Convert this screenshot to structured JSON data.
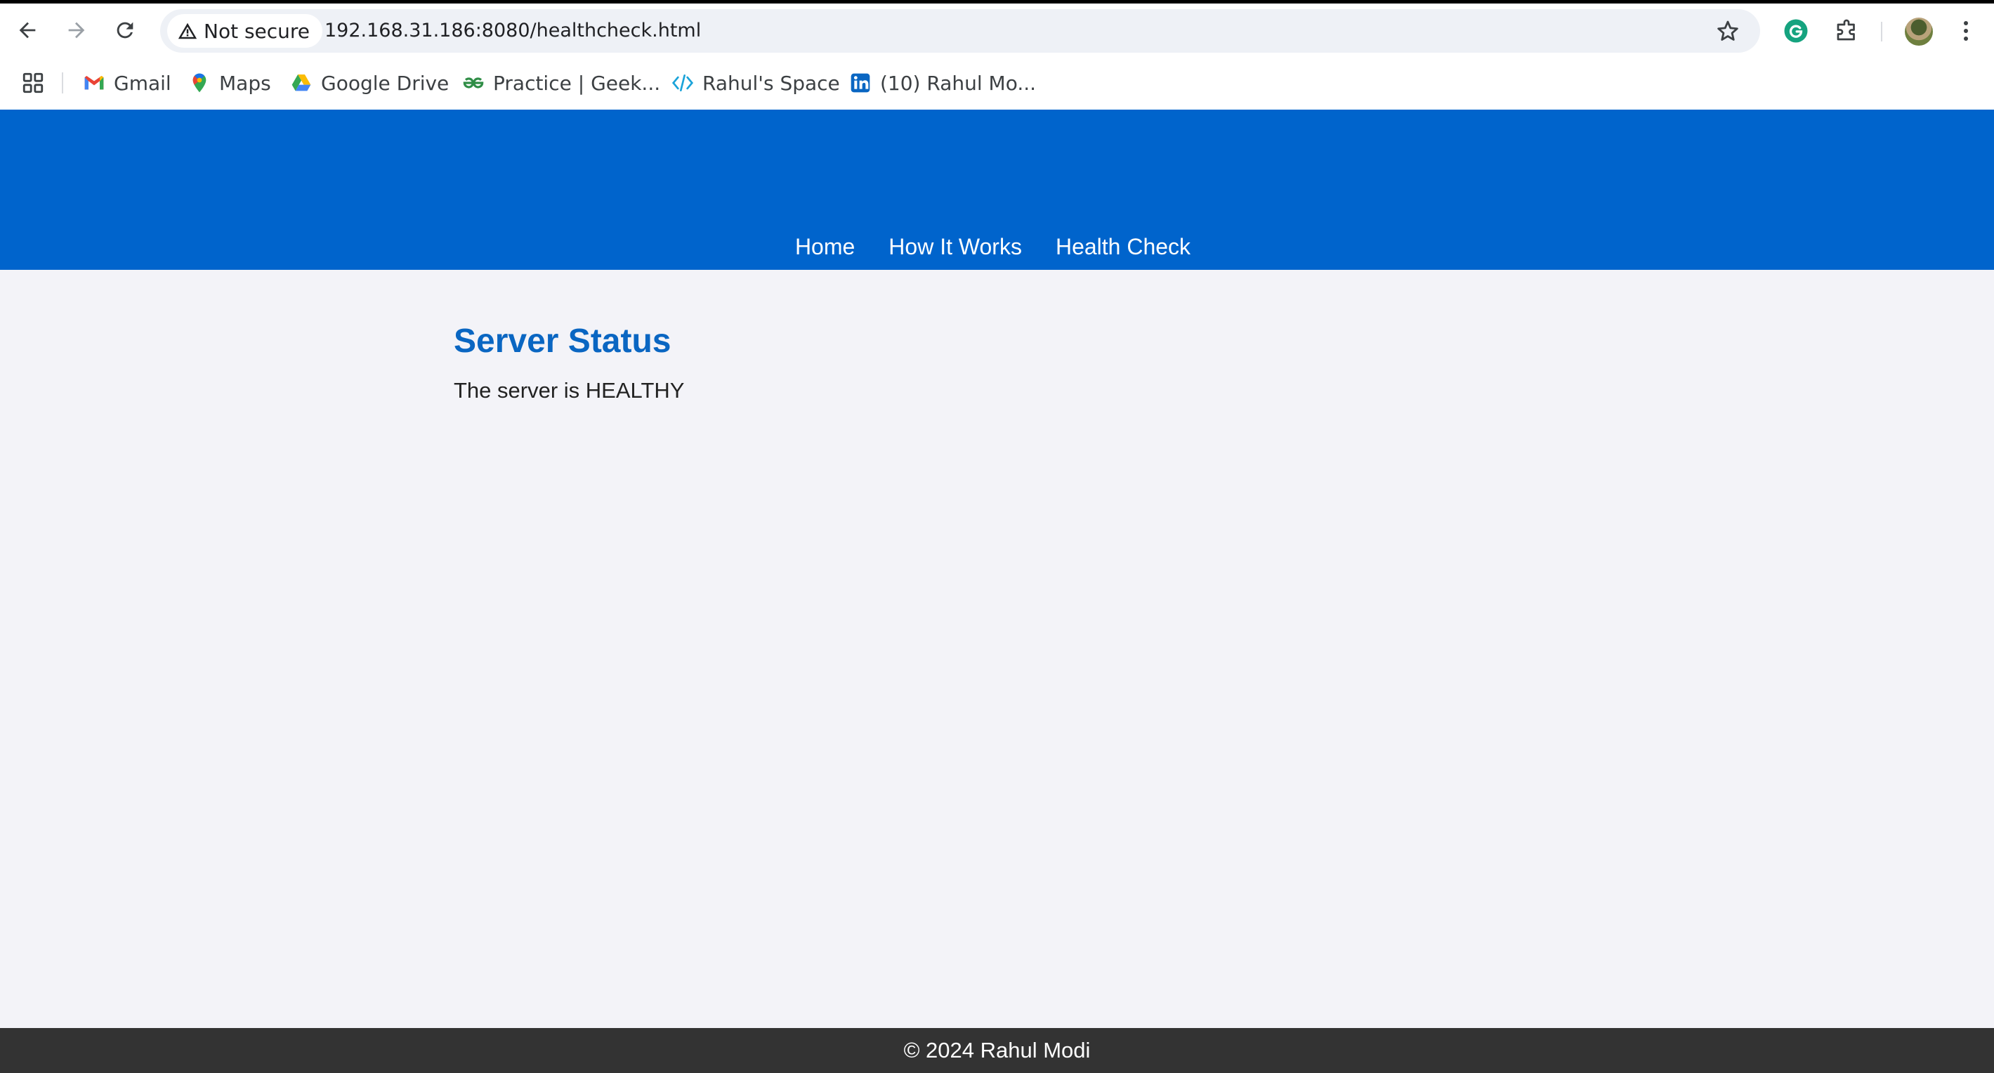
{
  "browser": {
    "security_label": "Not secure",
    "url": "192.168.31.186:8080/healthcheck.html",
    "bookmarks": [
      {
        "label": "Gmail",
        "icon": "gmail-icon"
      },
      {
        "label": "Maps",
        "icon": "maps-icon"
      },
      {
        "label": "Google Drive",
        "icon": "drive-icon"
      },
      {
        "label": "Practice | Geek...",
        "icon": "geeksforgeeks-icon"
      },
      {
        "label": "Rahul's Space",
        "icon": "code-icon"
      },
      {
        "label": "(10) Rahul Mo...",
        "icon": "linkedin-icon"
      }
    ]
  },
  "site": {
    "nav": {
      "home": "Home",
      "how_it_works": "How It Works",
      "health_check": "Health Check"
    },
    "main": {
      "heading": "Server Status",
      "status_text": "The server is HEALTHY"
    },
    "footer": {
      "text": "© 2024 Rahul Modi"
    }
  },
  "colors": {
    "header_bg": "#0064cc",
    "heading": "#0a66c2",
    "page_bg": "#f3f3f8",
    "footer_bg": "#333333"
  }
}
